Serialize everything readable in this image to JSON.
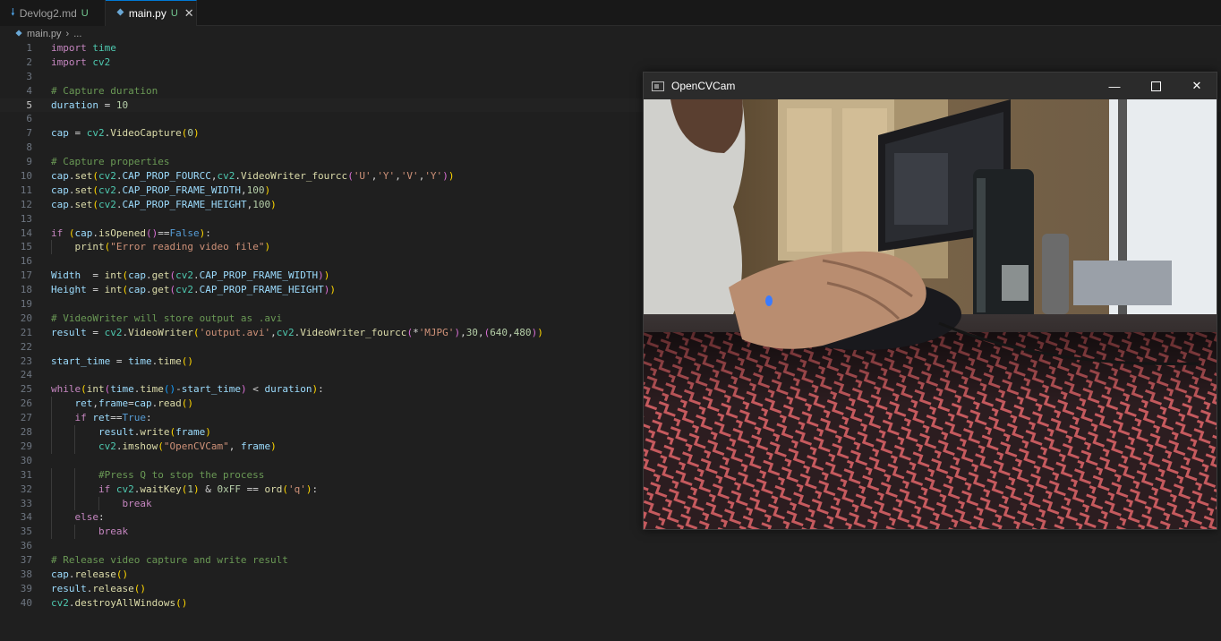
{
  "tabs": [
    {
      "label": "Devlog2.md",
      "status": "U",
      "icon": "markdown-icon"
    },
    {
      "label": "main.py",
      "status": "U",
      "icon": "python-icon",
      "active": true
    }
  ],
  "breadcrumb": {
    "file": "main.py",
    "more": "..."
  },
  "editor": {
    "current_line": 5,
    "lines": [
      "import time",
      "import cv2",
      "",
      "# Capture duration",
      "duration = 10",
      "",
      "cap = cv2.VideoCapture(0)",
      "",
      "# Capture properties",
      "cap.set(cv2.CAP_PROP_FOURCC,cv2.VideoWriter_fourcc('U','Y','V','Y'))",
      "cap.set(cv2.CAP_PROP_FRAME_WIDTH,100)",
      "cap.set(cv2.CAP_PROP_FRAME_HEIGHT,100)",
      "",
      "if (cap.isOpened()==False):",
      "    print(\"Error reading video file\")",
      "",
      "Width  = int(cap.get(cv2.CAP_PROP_FRAME_WIDTH))",
      "Height = int(cap.get(cv2.CAP_PROP_FRAME_HEIGHT))",
      "",
      "# VideoWriter will store output as .avi",
      "result = cv2.VideoWriter('output.avi',cv2.VideoWriter_fourcc(*'MJPG'),30,(640,480))",
      "",
      "start_time = time.time()",
      "",
      "while(int(time.time()-start_time) < duration):",
      "    ret,frame=cap.read()",
      "    if ret==True:",
      "        result.write(frame)",
      "        cv2.imshow(\"OpenCVCam\", frame)",
      "",
      "        #Press Q to stop the process",
      "        if cv2.waitKey(1) & 0xFF == ord('q'):",
      "            break",
      "    else:",
      "        break",
      "",
      "# Release video capture and write result",
      "cap.release()",
      "result.release()",
      "cv2.destroyAllWindows()"
    ]
  },
  "opencv_window": {
    "title": "OpenCVCam",
    "minimize_icon": "minimize-icon",
    "maximize_icon": "maximize-icon",
    "close_icon": "close-icon",
    "camera_frame": "camera-feed"
  },
  "colors": {
    "editor_bg": "#1f1f1f",
    "tab_accent": "#0078d4",
    "keyword": "#c586c0",
    "function": "#dcdcaa",
    "variable": "#9cdcfe",
    "string": "#ce9178",
    "comment": "#6a9955",
    "modified": "#73c991"
  }
}
